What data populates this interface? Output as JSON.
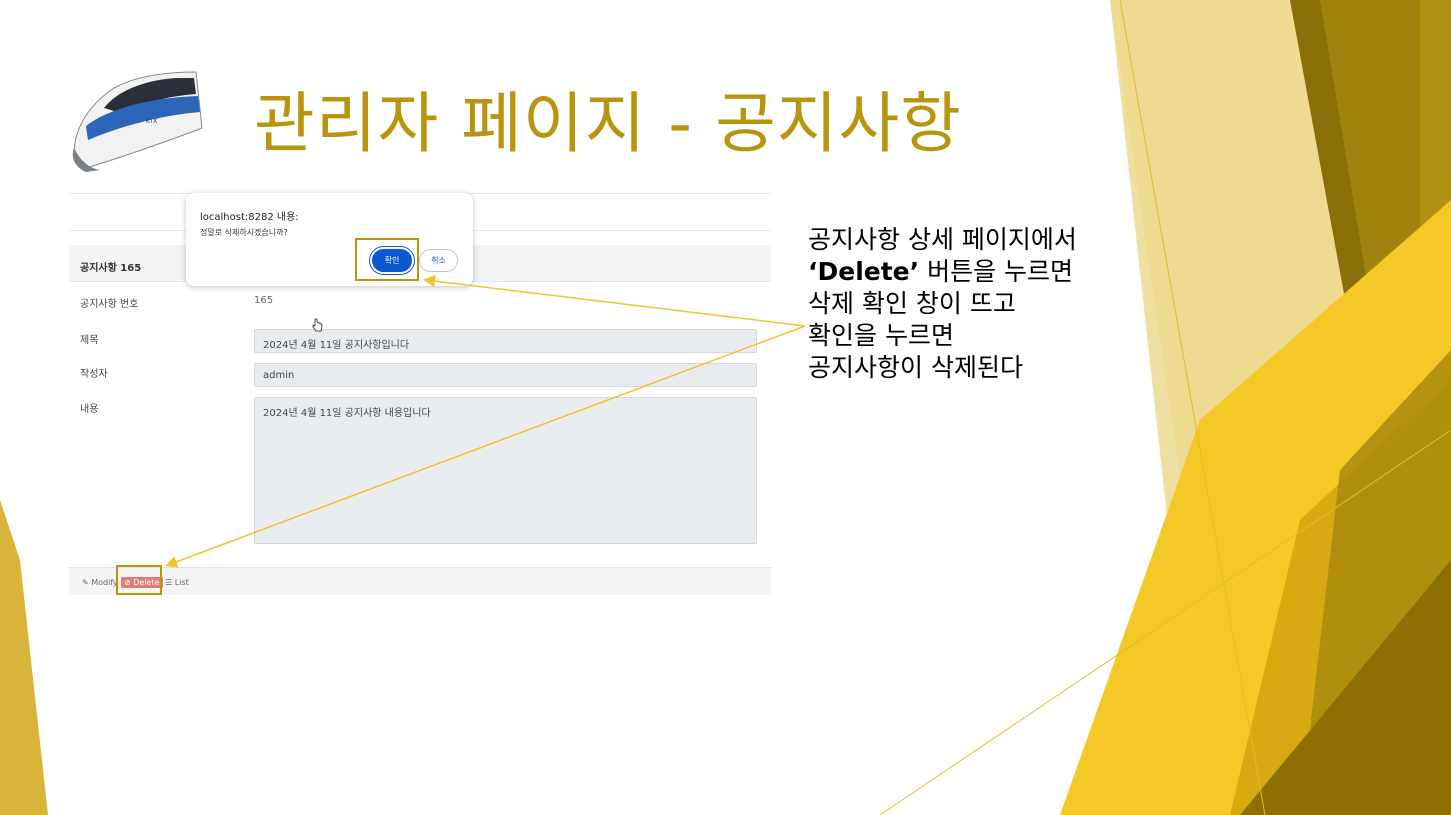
{
  "slide": {
    "title": "관리자 페이지 - 공지사항",
    "accent_color": "#B8940F",
    "train_image": "ktx-train-icon"
  },
  "app": {
    "card_title": "공지사항 165",
    "fields": {
      "number_label": "공지사항 번호",
      "number_value": "165",
      "title_label": "제목",
      "title_value": "2024년 4월 11일 공지사항입니다",
      "writer_label": "작성자",
      "writer_value": "admin",
      "content_label": "내용",
      "content_value": "2024년 4월 11일 공지사항 내용입니다"
    },
    "footer": {
      "modify_label": "Modify",
      "delete_label": "Delete",
      "list_label": "List"
    }
  },
  "dialog": {
    "origin": "localhost:8282 내용:",
    "message": "정말로 삭제하시겠습니까?",
    "ok_label": "확인",
    "cancel_label": "취소"
  },
  "description": {
    "line1": "공지사항 상세 페이지에서",
    "line2_bold": "‘Delete’",
    "line2_rest": " 버튼을 누르면",
    "line3": "삭제 확인 창이 뜨고",
    "line4": "확인을 누르면",
    "line5": "공지사항이 삭제된다"
  }
}
